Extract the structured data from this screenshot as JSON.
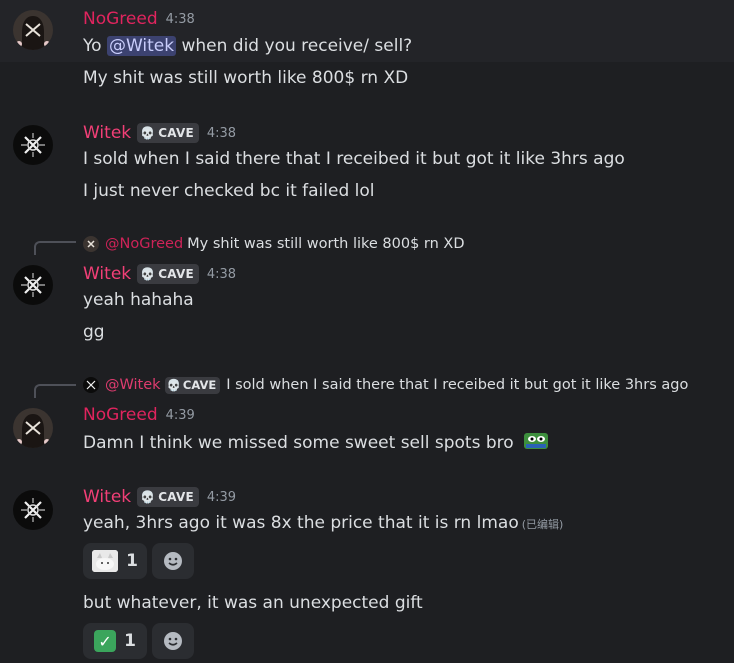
{
  "messages": [
    {
      "author": "NoGreed",
      "time": "4:38",
      "line1_prefix": "Yo ",
      "line1_mention": "@Witek",
      "line1_suffix": " when did you receive/ sell?",
      "line2": "My shit was still worth like 800$ rn XD"
    },
    {
      "author": "Witek",
      "tag": "CAVE",
      "time": "4:38",
      "line1": "I sold when I said there that I receibed it but got it like 3hrs ago",
      "line2": "I just never checked bc it failed lol"
    },
    {
      "reply_author": "@NoGreed",
      "reply_text": "My shit was still worth like 800$ rn XD",
      "author": "Witek",
      "tag": "CAVE",
      "time": "4:38",
      "line1": "yeah hahaha",
      "line2": "gg"
    },
    {
      "reply_author": "@Witek",
      "reply_tag": "CAVE",
      "reply_text": "I sold when I said there that I receibed it but got it like 3hrs ago",
      "author": "NoGreed",
      "time": "4:39",
      "line1": "Damn I think we missed some sweet sell spots bro",
      "emoji": "pepe-emoji"
    },
    {
      "author": "Witek",
      "tag": "CAVE",
      "time": "4:39",
      "line1": "yeah, 3hrs ago it was 8x the price that it is rn lmao",
      "edited": "(已编辑)",
      "reaction1": {
        "emoji": "cat-emoji",
        "count": "1"
      },
      "line2": "but whatever, it was an unexpected gift",
      "reaction2": {
        "emoji": "white-check-mark-emoji",
        "count": "1"
      }
    }
  ],
  "colors": {
    "background": "#1e1f22",
    "nogreed_name": "#e0245e",
    "witek_name": "#f23f77",
    "mention_bg": "#3c4270",
    "reaction_bg": "#2b2d31"
  }
}
